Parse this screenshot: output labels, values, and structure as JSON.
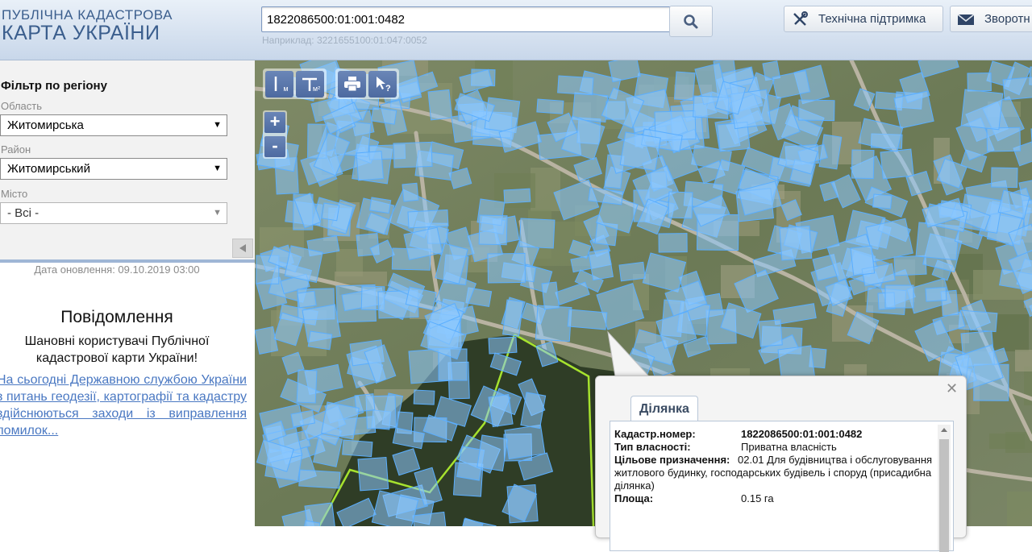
{
  "header": {
    "logo_line1": "ПУБЛІЧНА КАДАСТРОВА",
    "logo_line2": "КАРТА УКРАЇНИ",
    "search_value": "1822086500:01:001:0482",
    "search_hint": "Наприклад: 3221655100:01:047:0052",
    "support_label": "Технічна підтримка",
    "feedback_label": "Зворотн"
  },
  "filter": {
    "title": "Фільтр по регіону",
    "oblast_label": "Область",
    "oblast_value": "Житомирська",
    "raion_label": "Район",
    "raion_value": "Житомирський",
    "misto_label": "Місто",
    "misto_value": "- Всі -"
  },
  "sidebar": {
    "update_date": "Дата оновлення: 09.10.2019 03:00",
    "notice_title": "Повідомлення",
    "notice_text": "Шановні користувачі Публічної кадастрової карти України!",
    "notice_link": "На сьогодні Державною службою України з питань геодезії, картографії та кадастру здійснюються заходи із виправлення помилок..."
  },
  "map_tools": {
    "distance_label": "м",
    "area_label": "м²",
    "zoom_in": "+",
    "zoom_out": "-"
  },
  "popup": {
    "tab_label": "Ділянка",
    "rows": [
      {
        "key": "Кадастр.номер:",
        "value": "1822086500:01:001:0482"
      },
      {
        "key": "Тип власності:",
        "value": "Приватна власність"
      },
      {
        "key": "Цільове призначення:",
        "value": "02.01 Для будівництва і обслуговування житлового будинку, господарських будівель і споруд (присадибна ділянка)"
      },
      {
        "key": "Площа:",
        "value": "0.15 га"
      }
    ]
  },
  "colors": {
    "brand": "#3b5e8d",
    "parcel_fill": "#8cc8ff",
    "parcel_stroke": "#5aaeff",
    "highlight": "#a6e22e"
  }
}
